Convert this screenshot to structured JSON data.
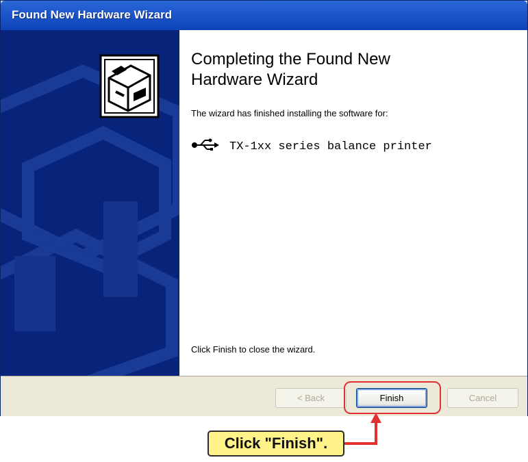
{
  "window": {
    "title": "Found New Hardware Wizard"
  },
  "content": {
    "heading_line1": "Completing the Found New",
    "heading_line2": "Hardware Wizard",
    "finished_text": "The wizard has finished installing the software for:",
    "device_icon": "usb-icon",
    "device_name": "TX-1xx series balance printer",
    "close_hint": "Click Finish to close the wizard."
  },
  "buttons": {
    "back_label": "< Back",
    "finish_label": "Finish",
    "cancel_label": "Cancel"
  },
  "annotation": {
    "callout_text": "Click \"Finish\".",
    "highlight_color": "#e03030",
    "callout_color": "#fff38a"
  },
  "colors": {
    "titlebar": "#1d55cb",
    "side_panel": "#08247a",
    "dialog_bg": "#ece9d8"
  }
}
